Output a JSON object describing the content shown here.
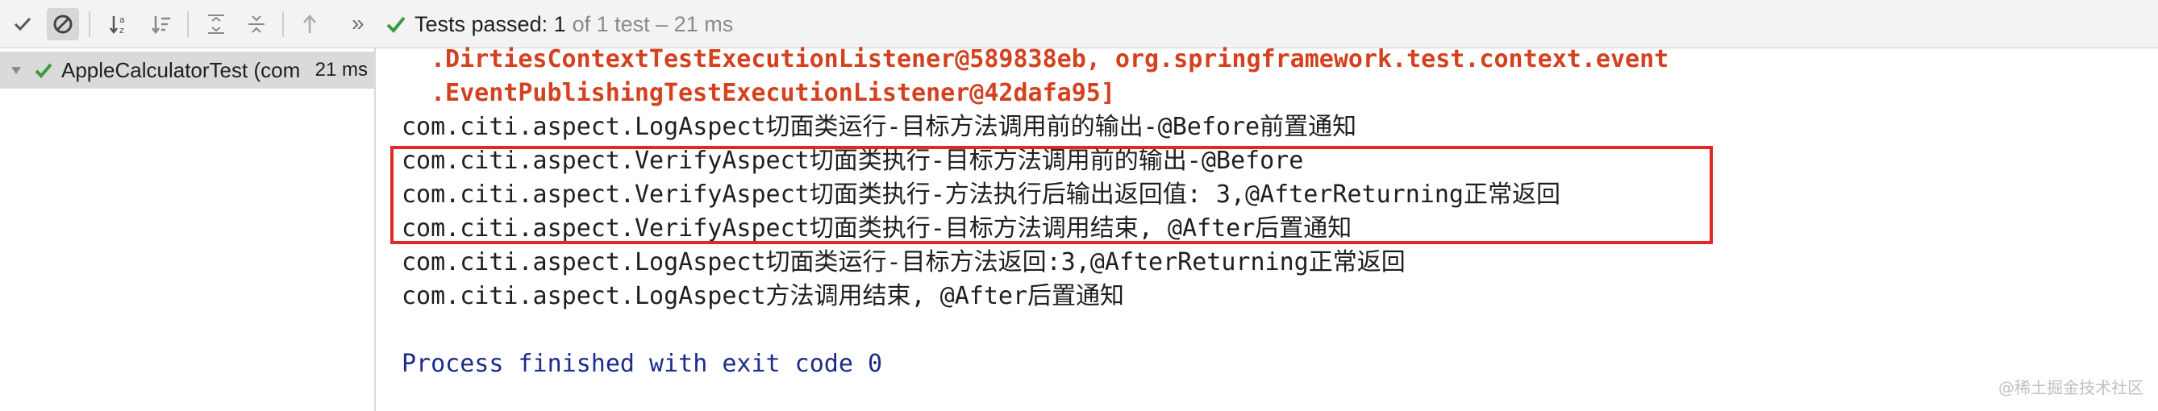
{
  "toolbar": {
    "buttons": [
      "checkmark-icon",
      "ignored-filter-icon",
      "sort-alpha-icon",
      "sort-duration-icon",
      "expand-all-icon",
      "collapse-all-icon",
      "previous-failed-icon"
    ],
    "more_label": "»",
    "status_main": "Tests passed: 1",
    "status_detail": "of 1 test – 21 ms"
  },
  "tree": {
    "item_label": "AppleCalculatorTest (com",
    "item_time": "21 ms"
  },
  "console": {
    "lines": [
      ".DirtiesContextTestExecutionListener@589838eb, org.springframework.test.context.event",
      ".EventPublishingTestExecutionListener@42dafa95]",
      "com.citi.aspect.LogAspect切面类运行-目标方法调用前的输出-@Before前置通知",
      "com.citi.aspect.VerifyAspect切面类执行-目标方法调用前的输出-@Before",
      "com.citi.aspect.VerifyAspect切面类执行-方法执行后输出返回值: 3,@AfterReturning正常返回",
      "com.citi.aspect.VerifyAspect切面类执行-目标方法调用结束, @After后置通知",
      "com.citi.aspect.LogAspect切面类运行-目标方法返回:3,@AfterReturning正常返回",
      "com.citi.aspect.LogAspect方法调用结束, @After后置通知",
      "Process finished with exit code 0"
    ],
    "watermark": "@稀土掘金技术社区"
  },
  "colors": {
    "pass_green": "#3c9a3c",
    "error_text": "#d3411f",
    "process_text": "#1c2c8c",
    "highlight_border": "#e02828"
  }
}
